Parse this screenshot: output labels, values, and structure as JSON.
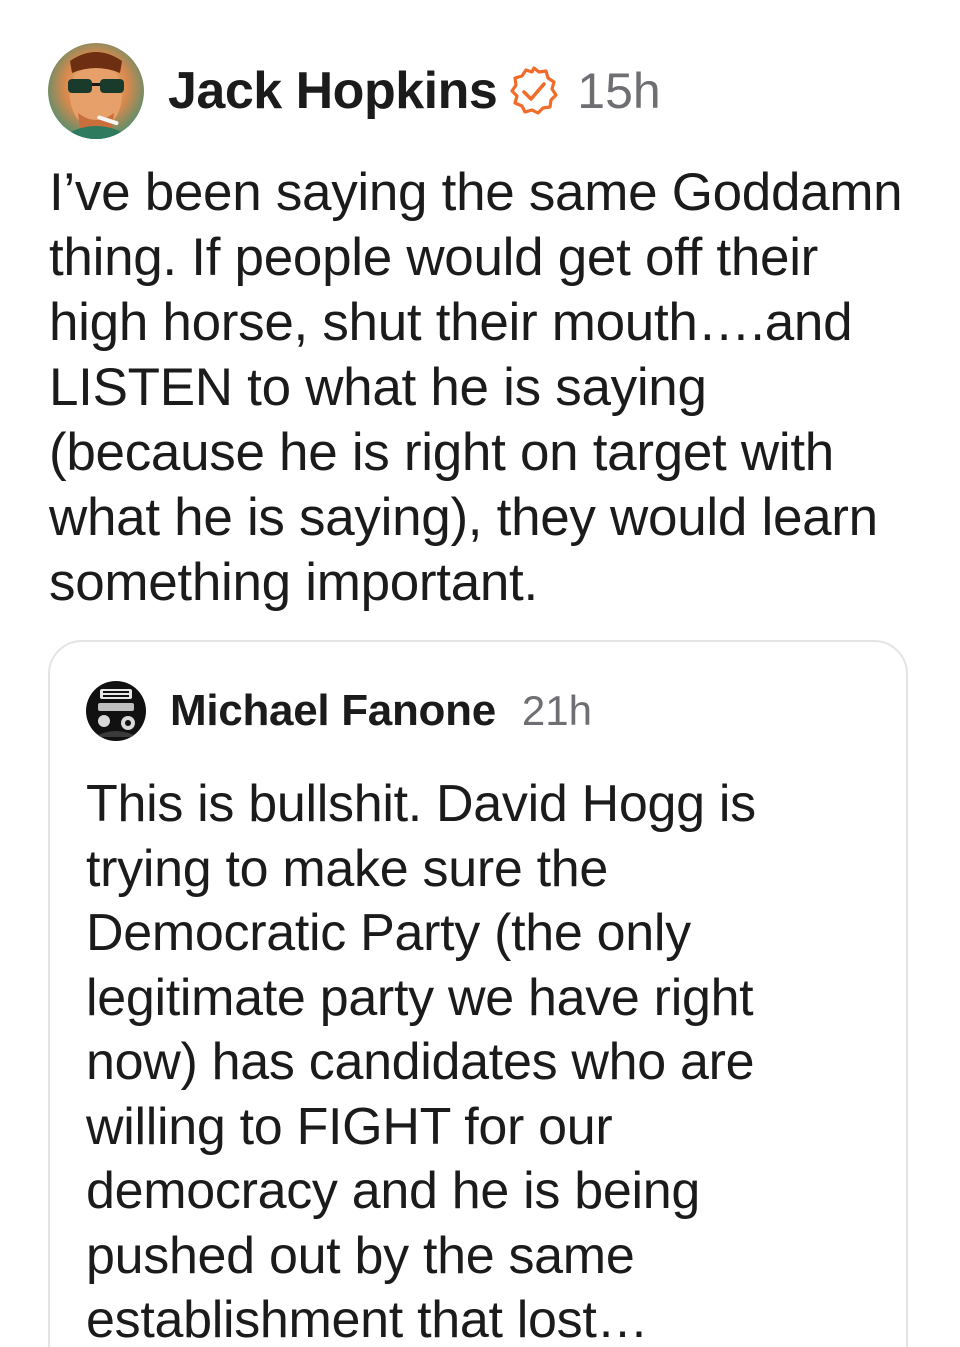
{
  "post": {
    "author": {
      "name": "Jack Hopkins",
      "avatar_icon": "avatar-photo-icon",
      "verified_icon": "verified-badge-icon",
      "verified_color": "#f06c2b"
    },
    "time": "15h",
    "body": "I’ve been saying the same Goddamn thing. If people would get off their high horse, shut their mouth….and LISTEN to what he is saying (because he is right on target with what he is saying), they would learn something important."
  },
  "quote": {
    "author": {
      "name": "Michael Fanone",
      "avatar_icon": "avatar-photo-icon"
    },
    "time": "21h",
    "body": "This is bullshit. David Hogg is trying to make sure the Democratic Party (the only legitimate party we have right now) has candidates who are willing to FIGHT for our democracy and he is being pushed out by the same establishment that lost…"
  },
  "colors": {
    "text": "#1b1b1b",
    "muted": "#6e6e73",
    "card_border": "#e4e4e6"
  }
}
